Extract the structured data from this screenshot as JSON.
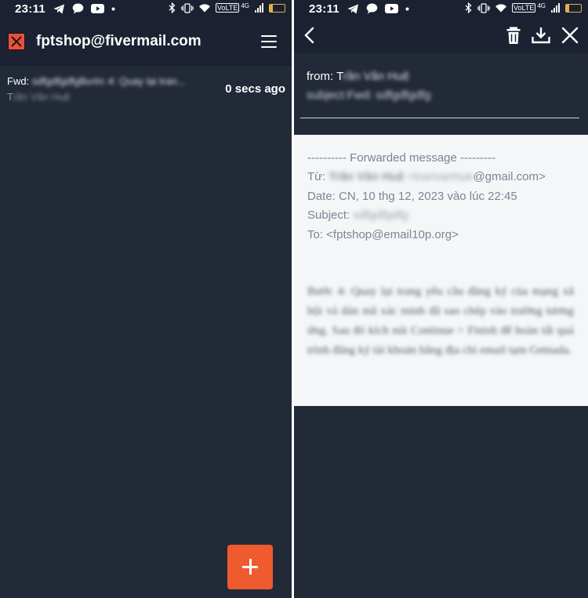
{
  "status_bar": {
    "time": "23:11",
    "volte": "VoLTE",
    "network": "4G",
    "battery": "18"
  },
  "inbox": {
    "account": "fptshop@fivermail.com",
    "email": {
      "subject_prefix": "Fwd: ",
      "subject_rest": "sdfgdfgdfgBước 4: Quay lại tran...",
      "sender_initial": "T",
      "sender_rest": "rần Văn Huệ",
      "time": "0 secs ago"
    },
    "fab_label": "+"
  },
  "message": {
    "from_label": "from: ",
    "from_initial": "T",
    "from_rest": "rần Văn Huệ",
    "subject_line": "subject:Fwd: sdfgdfgdfg",
    "forwarded_header": "---------- Forwarded message ---------",
    "tu_label": "Từ: ",
    "tu_name": "Trần Văn Huệ",
    "tu_email_local": "<tranvanhue",
    "tu_email_domain": "@gmail.com>",
    "date_line": "Date: CN, 10 thg 12, 2023 vào lúc 22:45",
    "subject_label": "Subject: ",
    "subject_value": "sdfgdfgdfg",
    "to_line": "To: <fptshop@email10p.org>",
    "body": "Bước 4: Quay lại trang yêu cầu đăng ký của mạng xã hội và dán mã xác minh đã sao chép vào trường tương ứng. Sau đó kích nút Continue > Finish để hoàn tất quá trình đăng ký tài khoản bằng địa chỉ email tạm Getnada."
  },
  "colors": {
    "background": "#232a37",
    "header": "#1c2231",
    "accent": "#ef5a2e",
    "logo": "#e5533d"
  },
  "icons": [
    "telegram-icon",
    "chat-bubble-icon",
    "youtube-icon",
    "bluetooth-icon",
    "vibrate-icon",
    "wifi-icon",
    "back-chevron-icon",
    "trash-icon",
    "download-icon",
    "close-icon",
    "hamburger-menu-icon",
    "plus-icon"
  ]
}
